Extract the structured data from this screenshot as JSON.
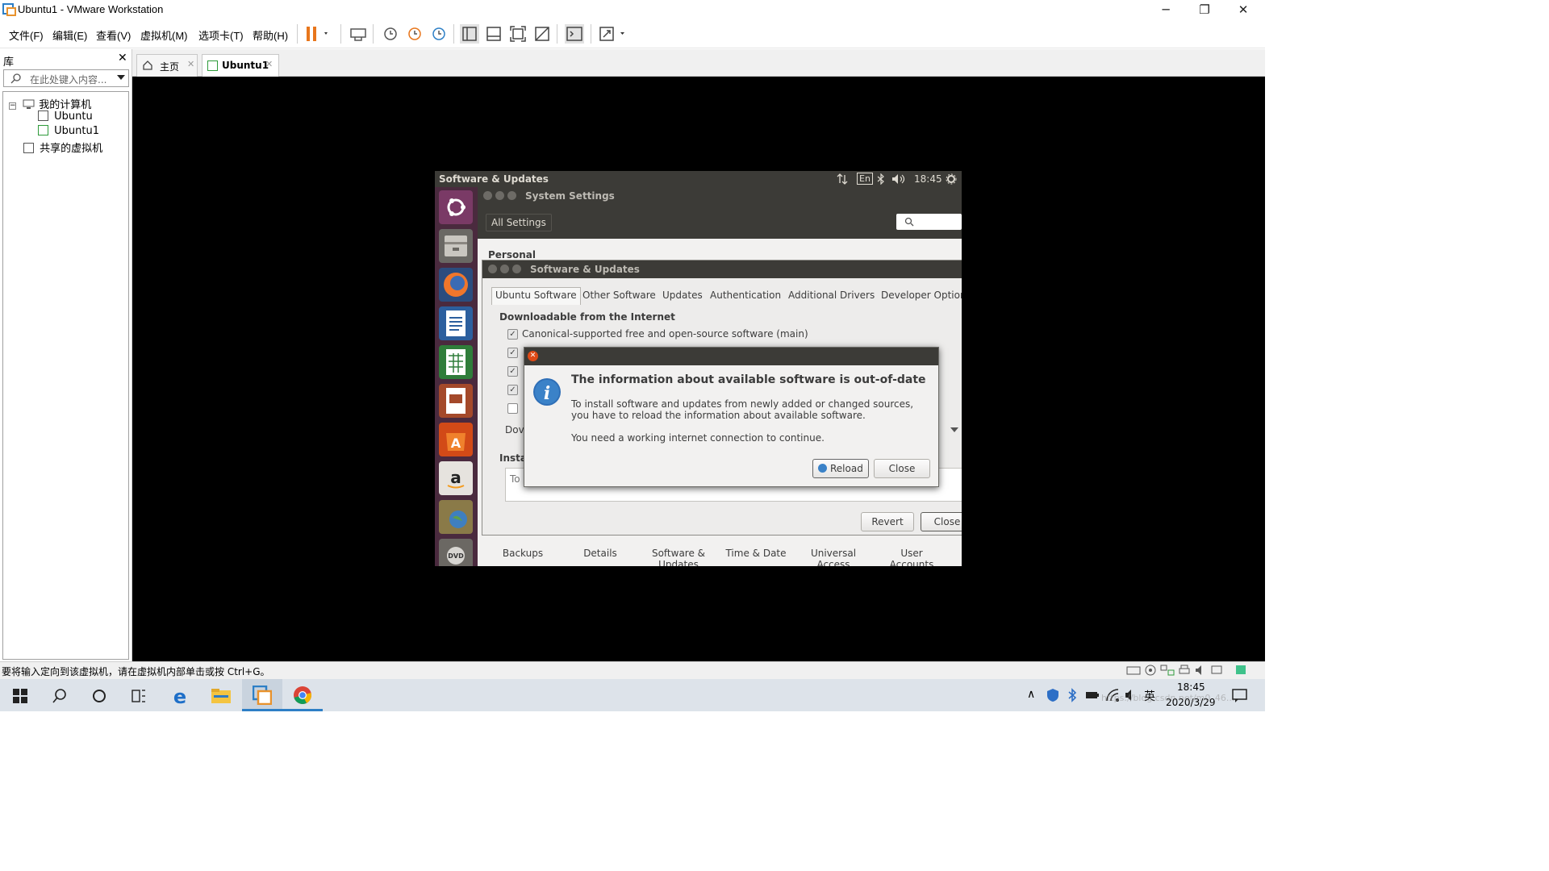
{
  "window": {
    "title": "Ubuntu1 - VMware Workstation",
    "minimize": "─",
    "restore": "❐",
    "close": "✕"
  },
  "menu": [
    "文件(F)",
    "编辑(E)",
    "查看(V)",
    "虚拟机(M)",
    "选项卡(T)",
    "帮助(H)"
  ],
  "library": {
    "header": "库",
    "close": "✕",
    "search_placeholder": "在此处键入内容...",
    "tree": {
      "root": "我的计算机",
      "vms": [
        "Ubuntu",
        "Ubuntu1"
      ],
      "shared": "共享的虚拟机"
    }
  },
  "tabs": [
    {
      "label": "主页",
      "active": false
    },
    {
      "label": "Ubuntu1",
      "active": true
    }
  ],
  "ubuntu": {
    "top_panel": {
      "title": "Software & Updates",
      "lang": "En",
      "time": "18:45"
    },
    "system_settings": {
      "title": "System Settings",
      "all_settings": "All Settings",
      "section": "Personal"
    },
    "software_updates": {
      "title": "Software & Updates",
      "tabs": [
        "Ubuntu Software",
        "Other Software",
        "Updates",
        "Authentication",
        "Additional Drivers",
        "Developer Option"
      ],
      "section_title": "Downloadable from the Internet",
      "main_option": "Canonical-supported free and open-source software (main)",
      "partial_dow": "Dov",
      "partial_insta": "Insta",
      "partial_to": "To",
      "revert": "Revert",
      "close": "Close"
    },
    "dialog": {
      "heading": "The information about available software is out-of-date",
      "body1": "To install software and updates from newly added or changed sources, you have to reload the information about available software.",
      "body2": "You need a working internet connection to continue.",
      "reload": "Reload",
      "close": "Close"
    },
    "bottom_items": [
      "Backups",
      "Details",
      "Software &\nUpdates",
      "Time & Date",
      "Universal\nAccess",
      "User\nAccounts"
    ]
  },
  "statusbar": {
    "text": "要将输入定向到该虚拟机，请在虚拟机内部单击或按 Ctrl+G。"
  },
  "taskbar": {
    "ime": "英",
    "time": "18:45",
    "date": "2020/3/29",
    "watermark": "https://blog.csdn.net/m0_46..."
  }
}
